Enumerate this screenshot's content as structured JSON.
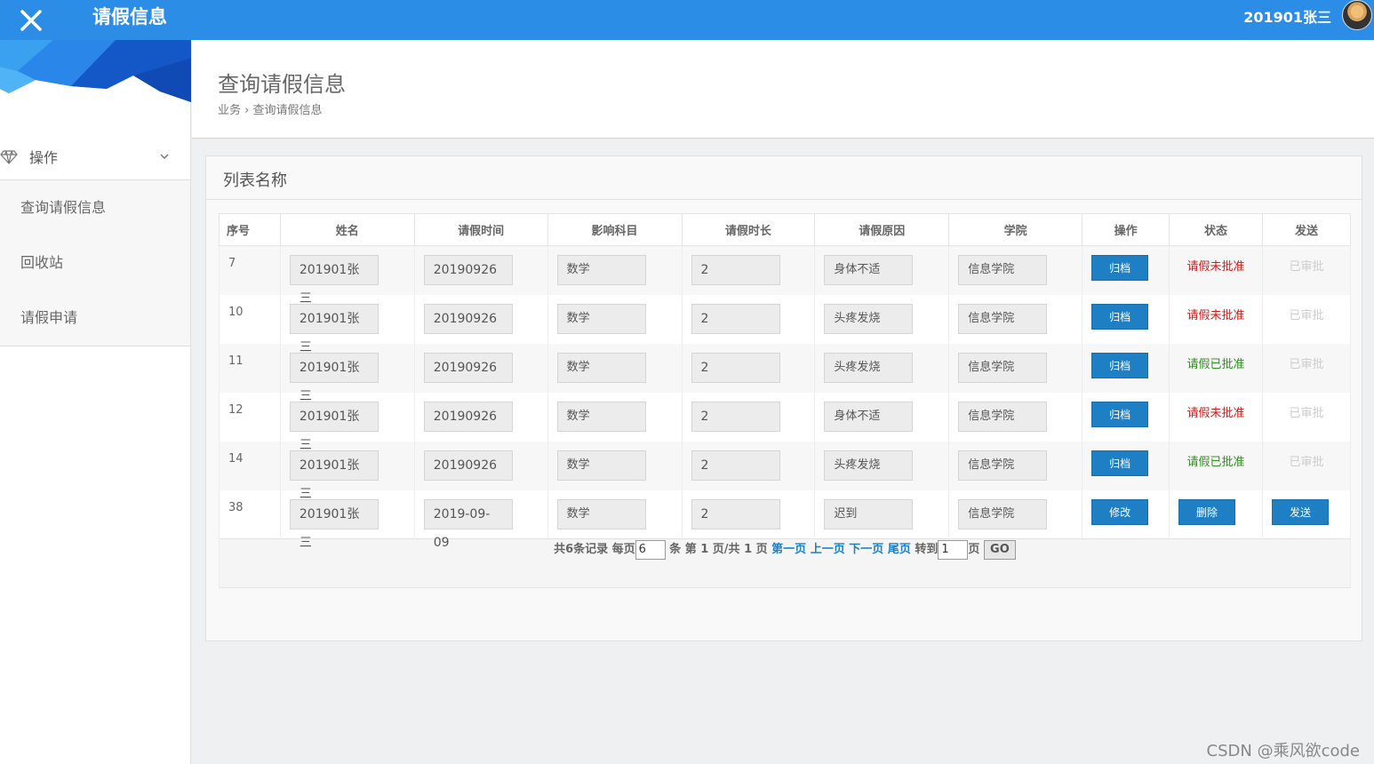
{
  "topbar": {
    "app_title": "请假信息",
    "user_name": "201901张三"
  },
  "sidebar": {
    "menu_label": "操作",
    "items": [
      {
        "label": "查询请假信息"
      },
      {
        "label": "回收站"
      },
      {
        "label": "请假申请"
      }
    ]
  },
  "page": {
    "title": "查询请假信息",
    "breadcrumb": "业务 › 查询请假信息"
  },
  "panel": {
    "title": "列表名称"
  },
  "table": {
    "headers": [
      "序号",
      "姓名",
      "请假时间",
      "影响科目",
      "请假时长",
      "请假原因",
      "学院",
      "操作",
      "状态",
      "发送"
    ],
    "rows": [
      {
        "id": "7",
        "name": "201901张三",
        "date": "20190926",
        "subject": "数学",
        "duration": "2",
        "reason": "身体不适",
        "college": "信息学院",
        "action": "归档",
        "status": "请假未批准",
        "send": "已审批"
      },
      {
        "id": "10",
        "name": "201901张三",
        "date": "20190926",
        "subject": "数学",
        "duration": "2",
        "reason": "头疼发烧",
        "college": "信息学院",
        "action": "归档",
        "status": "请假未批准",
        "send": "已审批"
      },
      {
        "id": "11",
        "name": "201901张三",
        "date": "20190926",
        "subject": "数学",
        "duration": "2",
        "reason": "头疼发烧",
        "college": "信息学院",
        "action": "归档",
        "status": "请假已批准",
        "send": "已审批"
      },
      {
        "id": "12",
        "name": "201901张三",
        "date": "20190926",
        "subject": "数学",
        "duration": "2",
        "reason": "身体不适",
        "college": "信息学院",
        "action": "归档",
        "status": "请假未批准",
        "send": "已审批"
      },
      {
        "id": "14",
        "name": "201901张三",
        "date": "20190926",
        "subject": "数学",
        "duration": "2",
        "reason": "头疼发烧",
        "college": "信息学院",
        "action": "归档",
        "status": "请假已批准",
        "send": "已审批"
      },
      {
        "id": "38",
        "name": "201901张三",
        "date": "2019-09-09",
        "subject": "数学",
        "duration": "2",
        "reason": "迟到",
        "college": "信息学院",
        "action": "修改",
        "status": "删除",
        "send": "发送"
      }
    ]
  },
  "pager": {
    "total_text": "共6条记录 每页",
    "per_page": "6",
    "page_info": "条 第 1 页/共 1 页",
    "first": "第一页",
    "prev": "上一页",
    "next": "下一页",
    "last": "尾页",
    "goto_label": "转到",
    "goto_value": "1",
    "page_suffix": "页",
    "go": "GO"
  },
  "watermark": "CSDN @乘风欲code",
  "colors": {
    "topbar": "#2b8de6",
    "button": "#1f7fc4",
    "status_red": "#d11b1b",
    "status_green": "#2f8f1f"
  }
}
